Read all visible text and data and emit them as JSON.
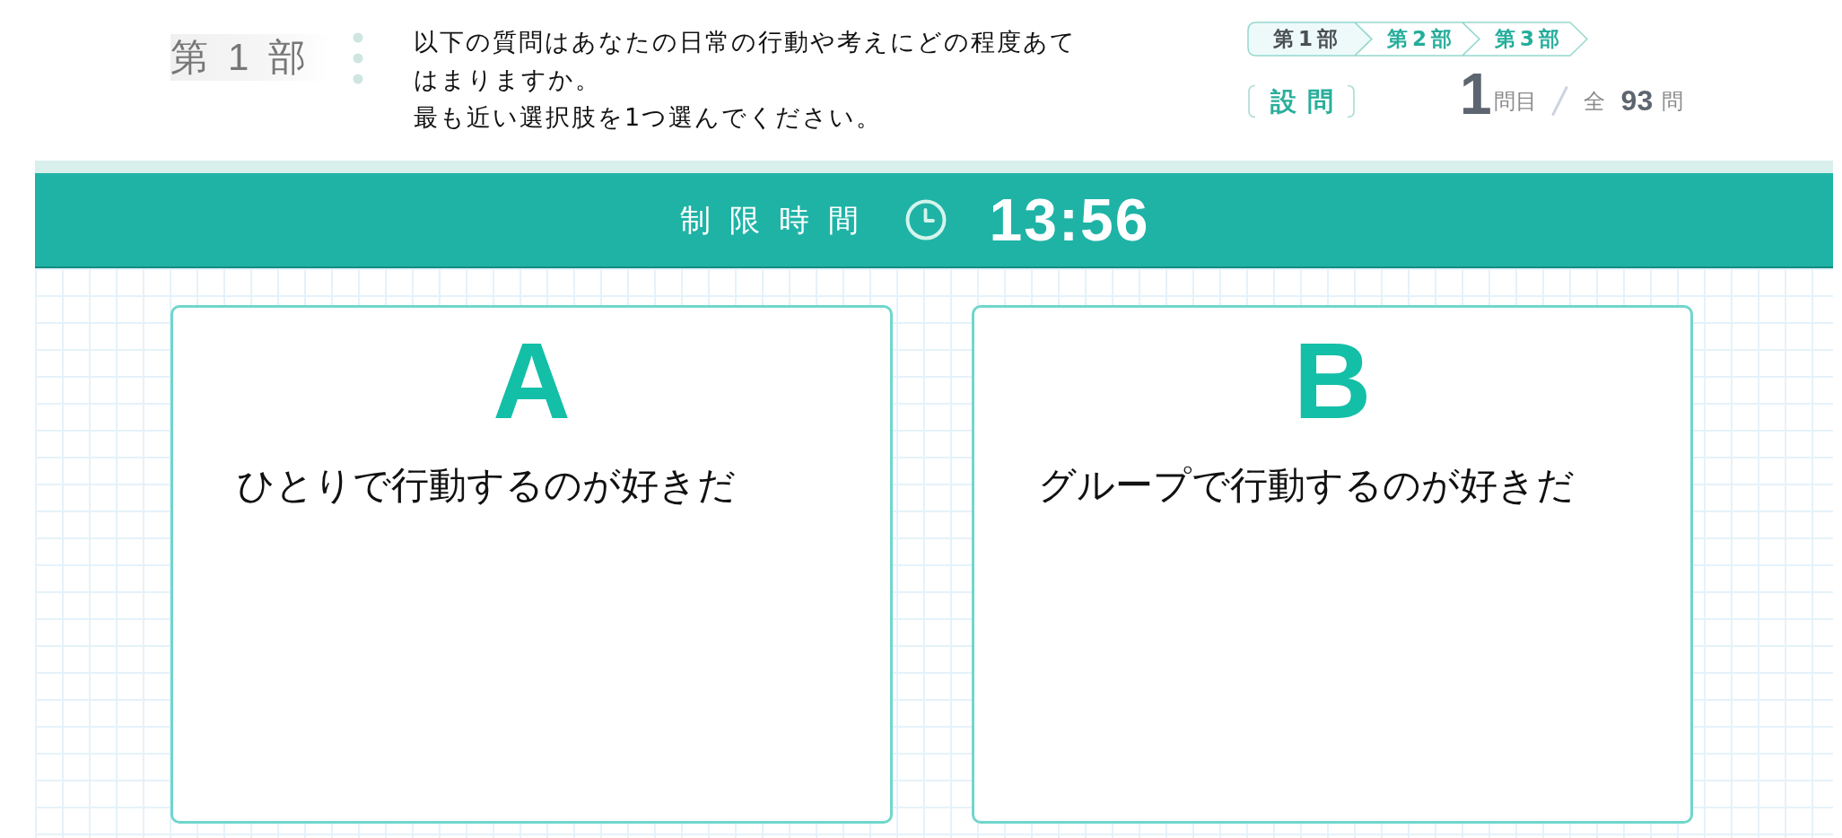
{
  "part_heading": "第1部",
  "instructions": [
    "以下の質問はあなたの日常の行動や考えにどの程度あてはまりますか。",
    "最も近い選択肢を1つ選んでください。"
  ],
  "steps": [
    {
      "label": "第1部",
      "current": true
    },
    {
      "label": "第2部",
      "current": false
    },
    {
      "label": "第3部",
      "current": false
    }
  ],
  "section_label": "設問",
  "counter": {
    "current": "1",
    "current_unit": "問目",
    "total_prefix": "全",
    "total": "93",
    "total_unit": "問"
  },
  "timer": {
    "label": "制限時間",
    "time": "13:56"
  },
  "options": [
    {
      "letter": "A",
      "text": "ひとりで行動するのが好きだ",
      "selected": false
    },
    {
      "letter": "B",
      "text": "グループで行動するのが好きだ",
      "selected": false
    }
  ]
}
